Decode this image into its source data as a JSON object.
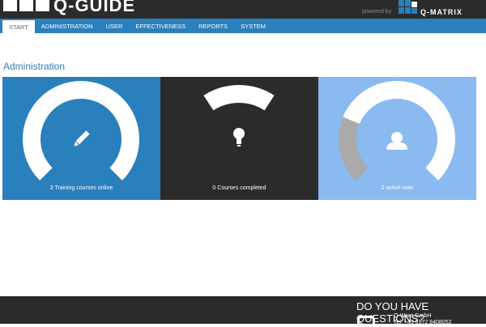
{
  "header": {
    "brand": "Q-GUIDE",
    "powered_by": "powered by",
    "partner": "Q-MATRIX"
  },
  "nav": {
    "items": [
      {
        "label": "START",
        "active": true
      },
      {
        "label": "ADMINISTRATION"
      },
      {
        "label": "USER"
      },
      {
        "label": "EFFECTIVENESS"
      },
      {
        "label": "REPORTS"
      },
      {
        "label": "SYSTEM"
      }
    ]
  },
  "page_title": "Administration",
  "panels": [
    {
      "label": "3 Training courses online",
      "icon": "pencil-icon",
      "color": "#2a7fbd",
      "gauge_fraction": 1.0
    },
    {
      "label": "0 Courses completed",
      "icon": "lightbulb-icon",
      "color": "#2b2b2b",
      "gauge_fraction": 0.0
    },
    {
      "label": "2 active user",
      "icon": "user-icon",
      "color": "#8abaf0",
      "gauge_gray_fraction": 0.25
    }
  ],
  "footer": {
    "question": "DO YOU HAVE QUESTIONS?",
    "company": "Q-Ware GmbH",
    "phone": "Tel: +49 5172 9408052"
  }
}
